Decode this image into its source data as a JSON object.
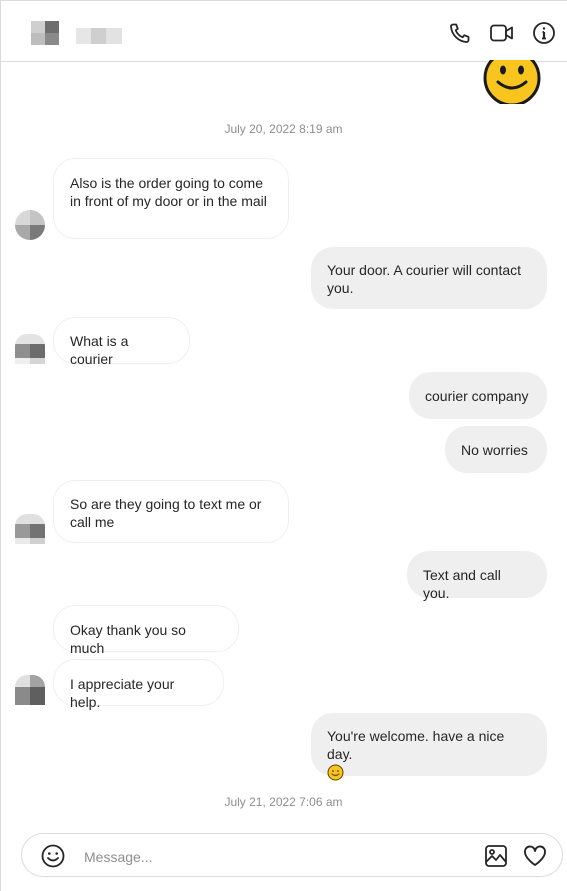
{
  "header": {
    "contact_name": "",
    "actions": [
      "phone-icon",
      "video-call-icon",
      "info-icon"
    ]
  },
  "colors": {
    "incoming_bubble": "#ffffff",
    "outgoing_bubble": "#efefef",
    "border": "#dbdbdb",
    "emoji_yellow": "#f7c51e"
  },
  "messages": {
    "ts1": "July 20, 2022 8:19 am",
    "m1": "Also is the order going to come in front of my door or in the mail",
    "m2": "Your door. A courier will contact you.",
    "m3": "What is a courier",
    "m4": "courier company",
    "m5": "No worries",
    "m6": "So are they going to text me or call me",
    "m7": "Text and call you.",
    "m8": "Okay thank you so much",
    "m9": "I appreciate your help.",
    "m10": "You're welcome. have a nice day.",
    "m10_emoji": "slightly-smiling-face-emoji",
    "ts2": "July 21, 2022 7:06 am"
  },
  "composer": {
    "placeholder": "Message...",
    "value": ""
  }
}
